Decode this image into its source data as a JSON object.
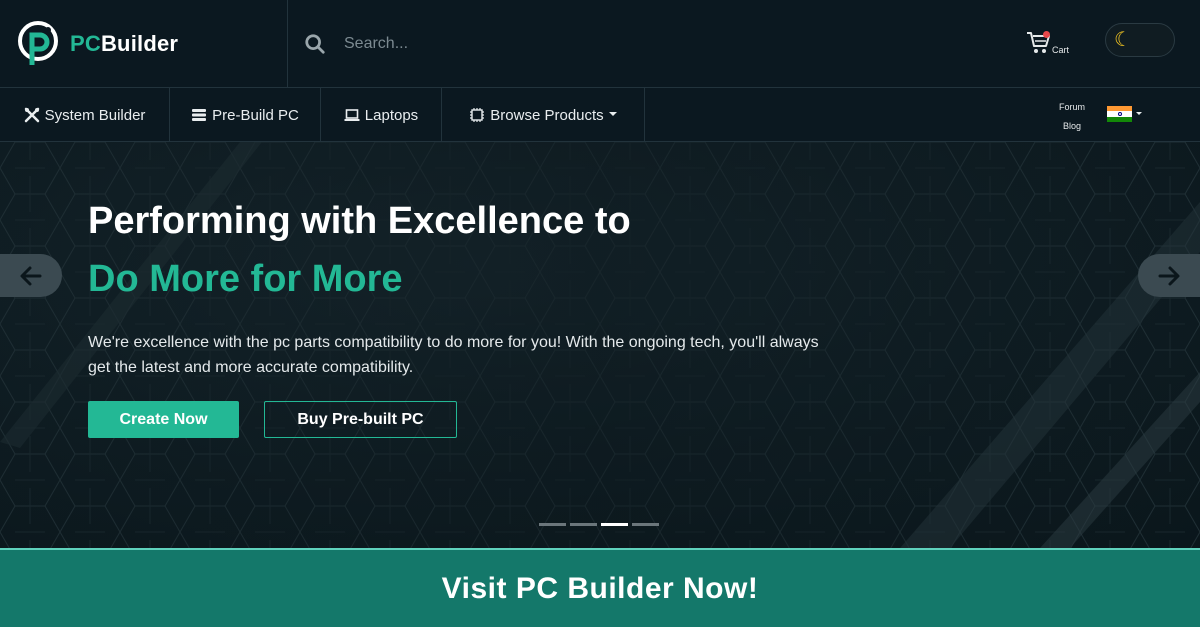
{
  "brand": {
    "pc": "PC",
    "builder": "Builder",
    "accent_color": "#23b895"
  },
  "search": {
    "placeholder": "Search...",
    "icon": "search-icon"
  },
  "header": {
    "cart_label": "Cart",
    "cart_icon": "cart-icon",
    "theme_toggle_icon": "moon-icon"
  },
  "nav": {
    "items": [
      {
        "label": "System Builder",
        "icon": "tools-icon"
      },
      {
        "label": "Pre-Build PC",
        "icon": "server-icon"
      },
      {
        "label": "Laptops",
        "icon": "laptop-icon"
      },
      {
        "label": "Browse Products",
        "icon": "chip-icon",
        "dropdown": true
      }
    ],
    "forum": "Forum",
    "blog": "Blog",
    "language_flag": "india-flag-icon"
  },
  "hero": {
    "title_line1": "Performing with Excellence to",
    "title_line2": "Do More for More",
    "description": "We're excellence with the pc parts compatibility to do more for you! With the ongoing tech, you'll always get the latest and more accurate compatibility.",
    "primary_button": "Create Now",
    "secondary_button": "Buy Pre-built PC",
    "slide_count": 4,
    "active_slide": 3
  },
  "banner": {
    "text": "Visit PC Builder Now!",
    "color": "#14786a"
  }
}
